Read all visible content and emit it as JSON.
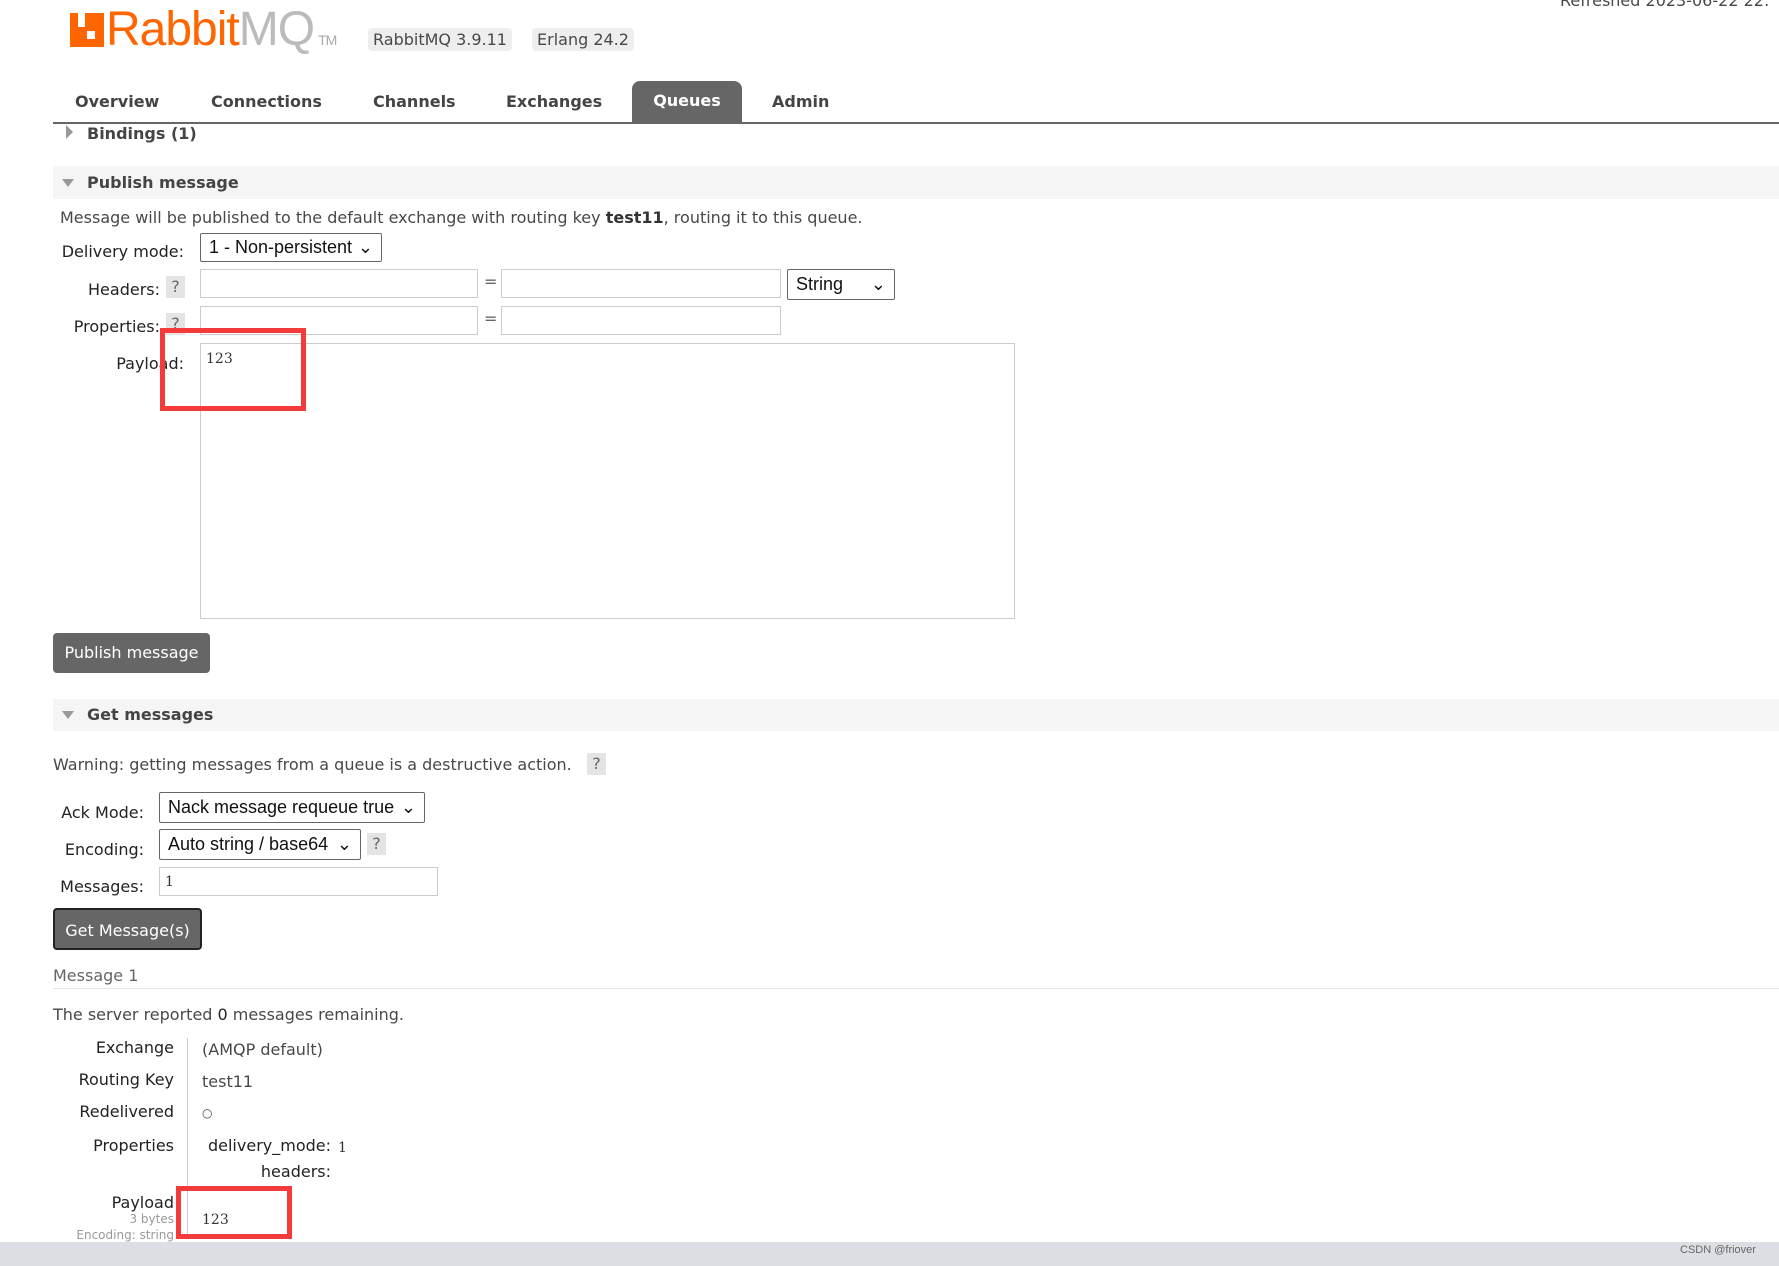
{
  "header": {
    "logo_text_orange": "Rabbit",
    "logo_text_gray": "MQ",
    "logo_tm": "TM",
    "version": "RabbitMQ 3.9.11",
    "erlang": "Erlang 24.2",
    "refreshed": "Refreshed 2023-06-22 22:"
  },
  "nav": {
    "tabs": [
      "Overview",
      "Connections",
      "Channels",
      "Exchanges",
      "Queues",
      "Admin"
    ],
    "active": "Queues"
  },
  "bindings": {
    "label": "Bindings (1)"
  },
  "publish": {
    "title": "Publish message",
    "info_pre": "Message will be published to the default exchange with routing key ",
    "info_key": "test11",
    "info_post": ", routing it to this queue.",
    "delivery_label": "Delivery mode:",
    "delivery_value": "1 - Non-persistent",
    "headers_label": "Headers:",
    "properties_label": "Properties:",
    "help": "?",
    "eq": "=",
    "type_value": "String",
    "payload_label": "Payload:",
    "payload_value": "123",
    "button": "Publish message"
  },
  "get": {
    "title": "Get messages",
    "warning": "Warning: getting messages from a queue is a destructive action.",
    "help": "?",
    "ack_label": "Ack Mode:",
    "ack_value": "Nack message requeue true",
    "encoding_label": "Encoding:",
    "encoding_value": "Auto string / base64",
    "messages_label": "Messages:",
    "messages_value": "1",
    "button": "Get Message(s)"
  },
  "result": {
    "title": "Message 1",
    "remaining_pre": "The server reported ",
    "remaining_count": "0",
    "remaining_post": " messages remaining.",
    "rows": [
      {
        "k": "Exchange",
        "v": "(AMQP default)"
      },
      {
        "k": "Routing Key",
        "v": "test11"
      },
      {
        "k": "Redelivered",
        "v": "○"
      }
    ],
    "properties_label": "Properties",
    "prop_delivery_key": "delivery_mode:",
    "prop_delivery_val": "1",
    "prop_headers_key": "headers:",
    "payload_label": "Payload",
    "payload_size": "3 bytes",
    "payload_encoding": "Encoding: string",
    "payload_value": "123"
  },
  "taskbar": {
    "watermark": "CSDN @friover"
  },
  "colors": {
    "brand": "#ff6600",
    "highlight": "#f33b3b",
    "tab_active": "#666666"
  }
}
